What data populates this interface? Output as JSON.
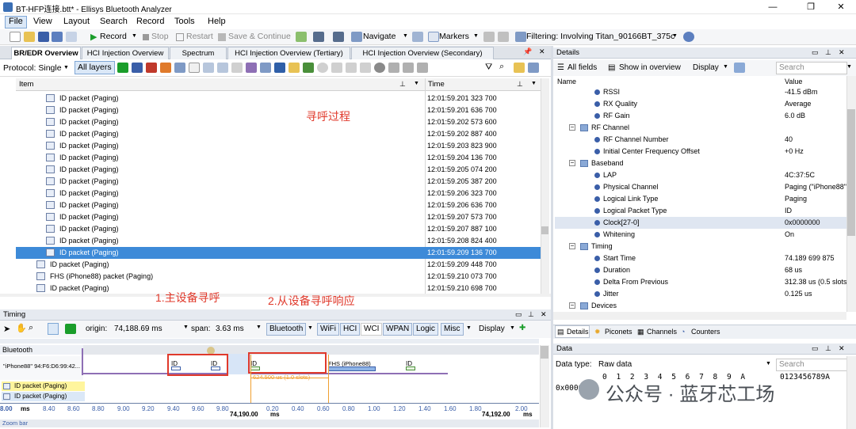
{
  "window": {
    "title": "BT-HFP连接.btt* - Ellisys Bluetooth Analyzer",
    "minimize": "—",
    "maximize": "❐",
    "close": "✕"
  },
  "menu": {
    "items": [
      "File",
      "View",
      "Layout",
      "Search",
      "Record",
      "Tools",
      "Help"
    ]
  },
  "toolbar": {
    "record": "Record",
    "stop": "Stop",
    "restart": "Restart",
    "save_continue": "Save & Continue",
    "navigate": "Navigate",
    "markers": "Markers",
    "filtering": "Filtering: Involving Titan_90166BT_375c"
  },
  "tabs": [
    {
      "label": "BR/EDR Overview"
    },
    {
      "label": "HCI Injection Overview"
    },
    {
      "label": "Spectrum"
    },
    {
      "label": "HCI Injection Overview (Tertiary)"
    },
    {
      "label": "HCI Injection Overview (Secondary)"
    }
  ],
  "protocol_bar": {
    "protocol": "Protocol: Single",
    "all_layers": "All layers"
  },
  "list": {
    "col_item": "Item",
    "col_time": "Time",
    "rows": [
      {
        "item": "ID packet (Paging)",
        "time": "12:01:59.201 323 700"
      },
      {
        "item": "ID packet (Paging)",
        "time": "12:01:59.201 636 700"
      },
      {
        "item": "ID packet (Paging)",
        "time": "12:01:59.202 573 600"
      },
      {
        "item": "ID packet (Paging)",
        "time": "12:01:59.202 887 400"
      },
      {
        "item": "ID packet (Paging)",
        "time": "12:01:59.203 823 900"
      },
      {
        "item": "ID packet (Paging)",
        "time": "12:01:59.204 136 700"
      },
      {
        "item": "ID packet (Paging)",
        "time": "12:01:59.205 074 200"
      },
      {
        "item": "ID packet (Paging)",
        "time": "12:01:59.205 387 200"
      },
      {
        "item": "ID packet (Paging)",
        "time": "12:01:59.206 323 700"
      },
      {
        "item": "ID packet (Paging)",
        "time": "12:01:59.206 636 700"
      },
      {
        "item": "ID packet (Paging)",
        "time": "12:01:59.207 573 700"
      },
      {
        "item": "ID packet (Paging)",
        "time": "12:01:59.207 887 100"
      },
      {
        "item": "ID packet (Paging)",
        "time": "12:01:59.208 824 400"
      },
      {
        "item": "ID packet (Paging)",
        "time": "12:01:59.209 136 700"
      },
      {
        "item": "ID packet (Paging)",
        "time": "12:01:59.209 448 700"
      },
      {
        "item": "FHS (iPhone88) packet (Paging)",
        "time": "12:01:59.210 073 700"
      },
      {
        "item": "ID packet (Paging)",
        "time": "12:01:59.210 698 700"
      }
    ],
    "annotation_paging": "寻呼过程",
    "annotation_master": "1.主设备寻呼",
    "annotation_slave": "2.从设备寻呼响应"
  },
  "timing": {
    "title": "Timing",
    "origin_label": "origin:",
    "origin_value": "74,188.69 ms",
    "span_label": "span:",
    "span_value": "3.63 ms",
    "filters": [
      "Bluetooth",
      "WiFi",
      "HCI",
      "WCI",
      "WPAN",
      "Logic",
      "Misc"
    ],
    "display": "Display",
    "track_group": "Bluetooth",
    "track_device": "\"iPhone88\" 94:F6:D6:99:42...",
    "bubbles": [
      "ID",
      "ID",
      "ID",
      "FHS (iPhone88)",
      "ID"
    ],
    "measure": "624.500 us (1.0 slots)",
    "legend": [
      "ID packet (Paging)",
      "ID packet (Paging)"
    ],
    "ticks_left": [
      "8.00",
      "8.40",
      "8.60",
      "8.80",
      "9.00",
      "9.20",
      "9.40",
      "9.60",
      "9.80"
    ],
    "ticks_right": [
      "0.20",
      "0.40",
      "0.60",
      "0.80",
      "1.00",
      "1.20",
      "1.40",
      "1.60",
      "1.80",
      "2.00"
    ],
    "tick_ms_left": "ms",
    "tick_center": "74,190.00",
    "tick_center_unit": "ms",
    "tick_right_big": "74,192.00",
    "tick_right_unit": "ms",
    "zoom_bar": "Zoom bar"
  },
  "details": {
    "title": "Details",
    "all_fields": "All fields",
    "show_overview": "Show in overview",
    "display": "Display",
    "search_placeholder": "Search",
    "col_name": "Name",
    "col_value": "Value",
    "rows": [
      {
        "label": "RSSI",
        "value": "-41.5 dBm",
        "kind": "leaf",
        "level": 2
      },
      {
        "label": "RX Quality",
        "value": "Average",
        "kind": "leaf",
        "level": 2
      },
      {
        "label": "RF Gain",
        "value": "6.0 dB",
        "kind": "leaf",
        "level": 2
      },
      {
        "label": "RF Channel",
        "value": "",
        "kind": "group",
        "level": 1
      },
      {
        "label": "RF Channel Number",
        "value": "40",
        "kind": "leaf",
        "level": 2
      },
      {
        "label": "Initial Center Frequency Offset",
        "value": "+0 Hz",
        "kind": "leaf",
        "level": 2
      },
      {
        "label": "Baseband",
        "value": "",
        "kind": "group",
        "level": 1
      },
      {
        "label": "LAP",
        "value": "4C:37:5C",
        "kind": "leaf",
        "level": 2
      },
      {
        "label": "Physical Channel",
        "value": "Paging (\"iPhone88\"",
        "kind": "leaf",
        "level": 2
      },
      {
        "label": "Logical Link Type",
        "value": "Paging",
        "kind": "leaf",
        "level": 2
      },
      {
        "label": "Logical Packet Type",
        "value": "ID",
        "kind": "leaf",
        "level": 2
      },
      {
        "label": "Clock[27-0]",
        "value": "0x0000000",
        "kind": "leaf",
        "level": 2
      },
      {
        "label": "Whitening",
        "value": "On",
        "kind": "leaf",
        "level": 2
      },
      {
        "label": "Timing",
        "value": "",
        "kind": "group",
        "level": 1
      },
      {
        "label": "Start Time",
        "value": "74.189 699 875",
        "kind": "leaf",
        "level": 2
      },
      {
        "label": "Duration",
        "value": "68 us",
        "kind": "leaf",
        "level": 2
      },
      {
        "label": "Delta From Previous",
        "value": "312.38 us (0.5 slots",
        "kind": "leaf",
        "level": 2
      },
      {
        "label": "Jitter",
        "value": "0.125 us",
        "kind": "leaf",
        "level": 2
      },
      {
        "label": "Devices",
        "value": "",
        "kind": "group",
        "level": 1
      }
    ],
    "bottom_tabs": [
      "Details",
      "Piconets",
      "Channels",
      "Counters"
    ]
  },
  "data_panel": {
    "title": "Data",
    "data_type_label": "Data type:",
    "data_type_value": "Raw data",
    "search_placeholder": "Search",
    "hex_header": "0 1 2 3 4 5 6 7 8 9 A",
    "ascii_header": "0123456789A",
    "offset": "0x0000:",
    "byte0": "1",
    "watermark": "公众号 · 蓝牙芯工场"
  },
  "colors": {
    "selection": "#3d8ad8",
    "annotation_red": "#e0392b",
    "accent_blue": "#3a5ea8"
  }
}
